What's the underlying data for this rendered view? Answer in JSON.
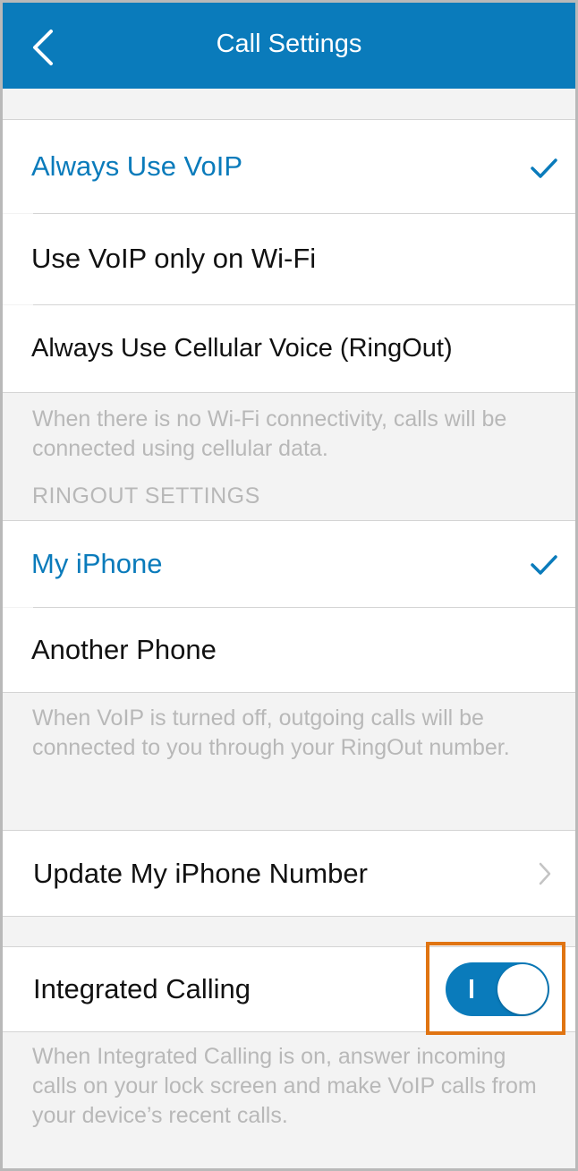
{
  "nav": {
    "title": "Call Settings",
    "back_icon": "chevron-left-icon"
  },
  "voip_options": [
    {
      "label": "Always Use VoIP",
      "selected": true
    },
    {
      "label": "Use VoIP only on Wi-Fi",
      "selected": false
    },
    {
      "label": "Always Use Cellular Voice (RingOut)",
      "selected": false
    }
  ],
  "voip_note": "When there is no Wi-Fi connectivity, calls will be connected using cellular data.",
  "ringout": {
    "header": "RINGOUT SETTINGS",
    "options": [
      {
        "label": "My iPhone",
        "selected": true
      },
      {
        "label": "Another Phone",
        "selected": false
      }
    ],
    "note": "When VoIP is turned off, outgoing calls will be connected to you through your RingOut number."
  },
  "update_number": {
    "label": "Update My iPhone Number",
    "icon": "chevron-right-icon"
  },
  "integrated_calling": {
    "label": "Integrated Calling",
    "enabled": true,
    "note": "When Integrated Calling is on, answer incoming calls on your lock screen and make VoIP calls from your device’s recent calls."
  },
  "colors": {
    "accent": "#0a7bbb",
    "highlight": "#e07412",
    "note_text": "#b8b8b8",
    "background": "#f3f3f3"
  }
}
